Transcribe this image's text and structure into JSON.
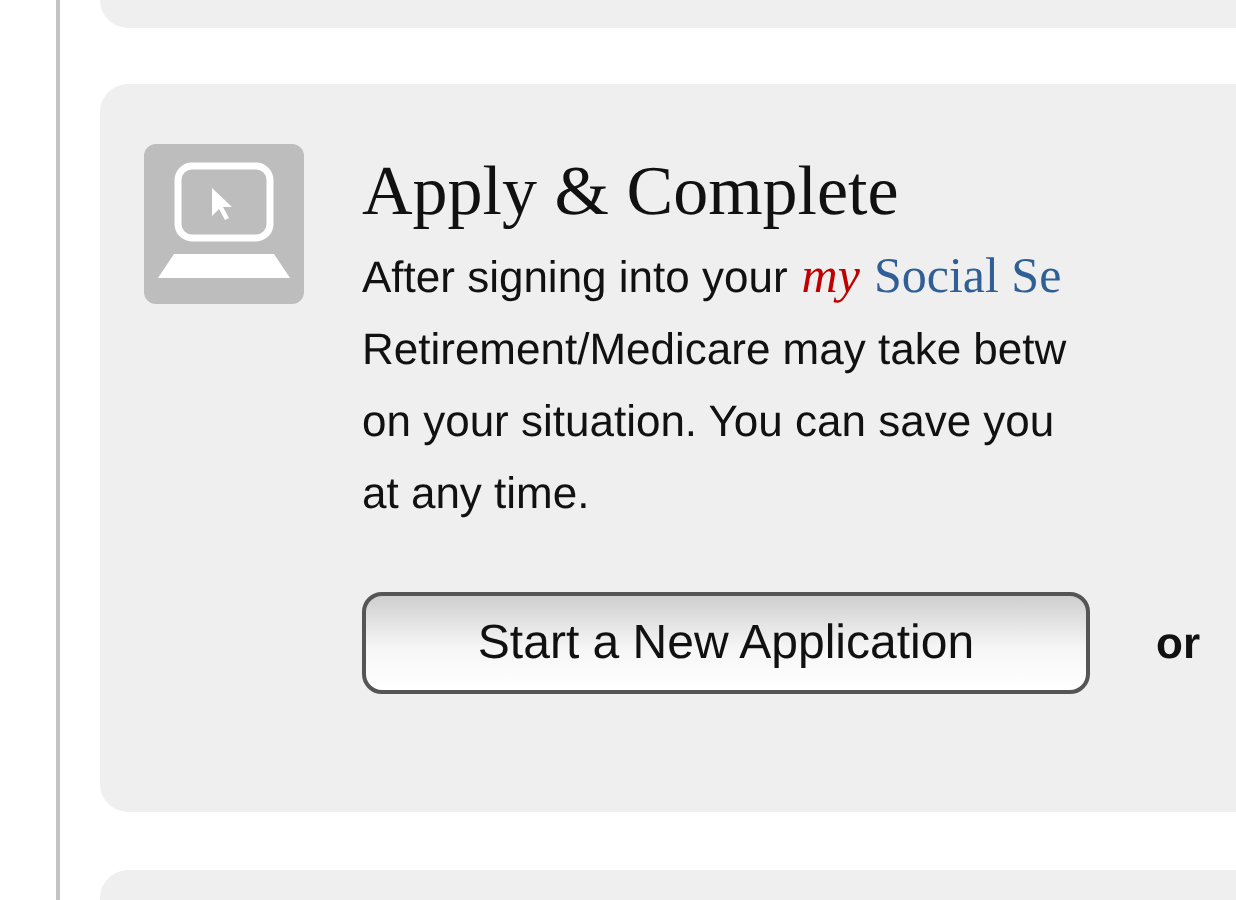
{
  "panel": {
    "title": "Apply & Complete",
    "lines": [
      [
        {
          "kind": "plain",
          "text": "After signing into your"
        },
        {
          "kind": "brand_my",
          "text": "my"
        },
        {
          "kind": "brand_name",
          "text": "Social Se"
        }
      ],
      [
        {
          "kind": "plain",
          "text": "Retirement/Medicare may take betw"
        }
      ],
      [
        {
          "kind": "plain",
          "text": "on your situation. You can save you"
        }
      ],
      [
        {
          "kind": "plain",
          "text": "at any time."
        }
      ]
    ],
    "primary_button": "Start a New Application",
    "separator": "or"
  }
}
